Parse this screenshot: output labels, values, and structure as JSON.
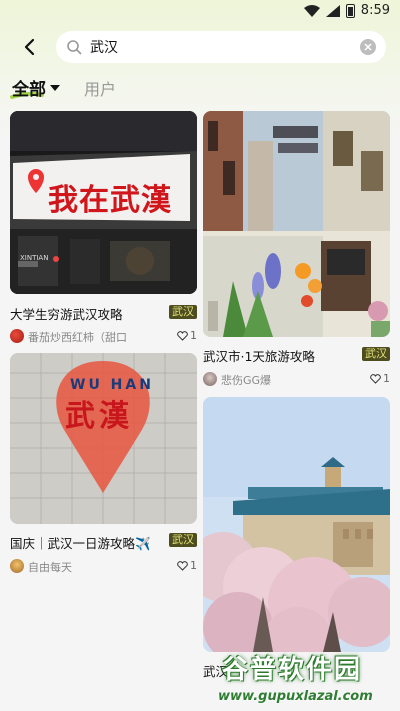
{
  "status_bar": {
    "time": "8:59"
  },
  "search": {
    "query": "武汉"
  },
  "tabs": {
    "all": "全部",
    "user": "用户"
  },
  "cards": [
    {
      "title": "大学生穷游武汉攻略",
      "tag": "武汉",
      "author": "番茄炒西红柿（甜口",
      "likes": "1",
      "image_sign_text": "我在武漢",
      "image_brand_text": "XINTIAN"
    },
    {
      "title": "国庆｜武汉一日游攻略✈️",
      "tag": "武汉",
      "author": "自由每天",
      "likes": "1",
      "image_title": "WU HAN",
      "image_big": "武漢"
    },
    {
      "title": "武汉市·1天旅游攻略",
      "tag": "武汉",
      "author": "悲伤GG爆",
      "likes": "1"
    },
    {
      "title": "武汉"
    }
  ],
  "watermark": {
    "main": "谷普软件园",
    "sub": "www.gupuxlazal.com"
  },
  "colors": {
    "tag_bg": "#4d4d1f",
    "tag_text": "#e6e27a",
    "accent": "#a7d34b"
  }
}
